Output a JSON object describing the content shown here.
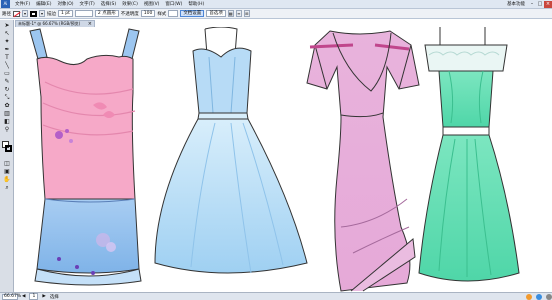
{
  "app": {
    "logo": "Ai",
    "document_tab": "未标题-1* @ 66.67% (RGB/预览)",
    "workspace": "基本功能",
    "window_controls": {
      "minimize": "–",
      "restore": "□",
      "close": "×"
    }
  },
  "menu": [
    "文件(F)",
    "编辑(E)",
    "对象(O)",
    "文字(T)",
    "选择(S)",
    "效果(C)",
    "视图(V)",
    "窗口(W)",
    "帮助(H)"
  ],
  "control_bar": {
    "selection": "路径",
    "stroke_label": "描边",
    "stroke_weight": "1 pt",
    "brush_size": "2 点圆形",
    "opacity_label": "不透明度",
    "opacity_value": "100",
    "style_label": "样式",
    "active_field": "文档设置",
    "prefs": "首选项"
  },
  "status": {
    "zoom": "66.67%",
    "page": "1",
    "tool_name": "选择"
  },
  "colors": {
    "chrome": "#dfe7f2",
    "accent": "#2b63b6",
    "dress1_top": "#f5a8c8",
    "dress1_skirt": "#9cc6f0",
    "dress2": "#bfe0f7",
    "dress3": "#e3a7d9",
    "dress4": "#6fe0b8"
  },
  "tools": [
    "selection-icon",
    "direct-selection-icon",
    "magic-wand-icon",
    "pen-icon",
    "type-icon",
    "line-icon",
    "rectangle-icon",
    "brush-icon",
    "pencil-icon",
    "rotate-icon",
    "scale-icon",
    "warp-icon",
    "free-transform-icon",
    "symbol-icon",
    "graph-icon",
    "mesh-icon",
    "gradient-icon",
    "eyedropper-icon",
    "blend-icon",
    "scissors-icon",
    "hand-icon",
    "zoom-icon"
  ]
}
